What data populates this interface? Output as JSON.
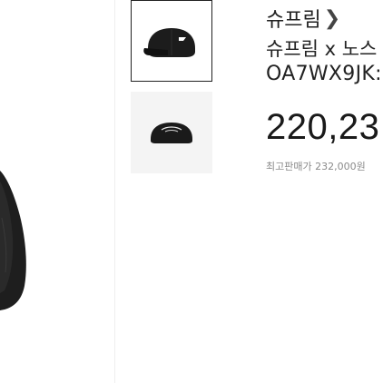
{
  "product": {
    "brand": "슈프림",
    "name": "슈프림 x 노스",
    "code": "OA7WX9JK:",
    "price": "220,23",
    "lowest_price": "최고판매가 232,000원"
  },
  "icons": {
    "brand_chevron": "chevron-right-icon"
  },
  "colors": {
    "text": "#222222",
    "muted": "#8a8a8a",
    "thumb_selected_border": "#222222"
  }
}
